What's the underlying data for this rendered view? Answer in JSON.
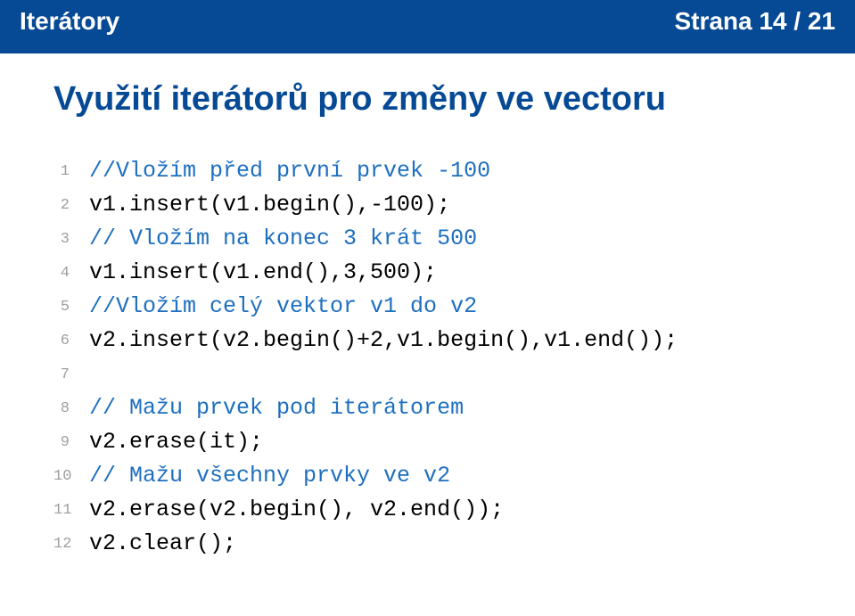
{
  "header": {
    "left": "Iterátory",
    "right": "Strana 14 / 21"
  },
  "title": "Využití iterátorů pro změny ve vectoru",
  "code": {
    "lines": [
      {
        "n": "1",
        "segments": [
          {
            "cls": "comment",
            "t": "//Vložím před první prvek -100"
          }
        ]
      },
      {
        "n": "2",
        "segments": [
          {
            "cls": "plain",
            "t": "v1.insert(v1.begin(),-100);"
          }
        ]
      },
      {
        "n": "3",
        "segments": [
          {
            "cls": "comment",
            "t": "// Vložím na konec 3 krát 500"
          }
        ]
      },
      {
        "n": "4",
        "segments": [
          {
            "cls": "plain",
            "t": "v1.insert(v1.end(),3,500);"
          }
        ]
      },
      {
        "n": "5",
        "segments": [
          {
            "cls": "comment",
            "t": "//Vložím celý vektor v1 do v2"
          }
        ]
      },
      {
        "n": "6",
        "segments": [
          {
            "cls": "plain",
            "t": "v2.insert(v2.begin()+2,v1.begin(),v1.end());"
          }
        ]
      },
      {
        "n": "7",
        "segments": []
      },
      {
        "n": "8",
        "segments": [
          {
            "cls": "comment",
            "t": "// Mažu prvek pod iterátorem"
          }
        ]
      },
      {
        "n": "9",
        "segments": [
          {
            "cls": "plain",
            "t": "v2.erase(it);"
          }
        ]
      },
      {
        "n": "10",
        "segments": [
          {
            "cls": "comment",
            "t": "// Mažu všechny prvky ve v2"
          }
        ]
      },
      {
        "n": "11",
        "segments": [
          {
            "cls": "plain",
            "t": "v2.erase(v2.begin(), v2.end());"
          }
        ]
      },
      {
        "n": "12",
        "segments": [
          {
            "cls": "plain",
            "t": "v2.clear();"
          }
        ]
      }
    ]
  }
}
